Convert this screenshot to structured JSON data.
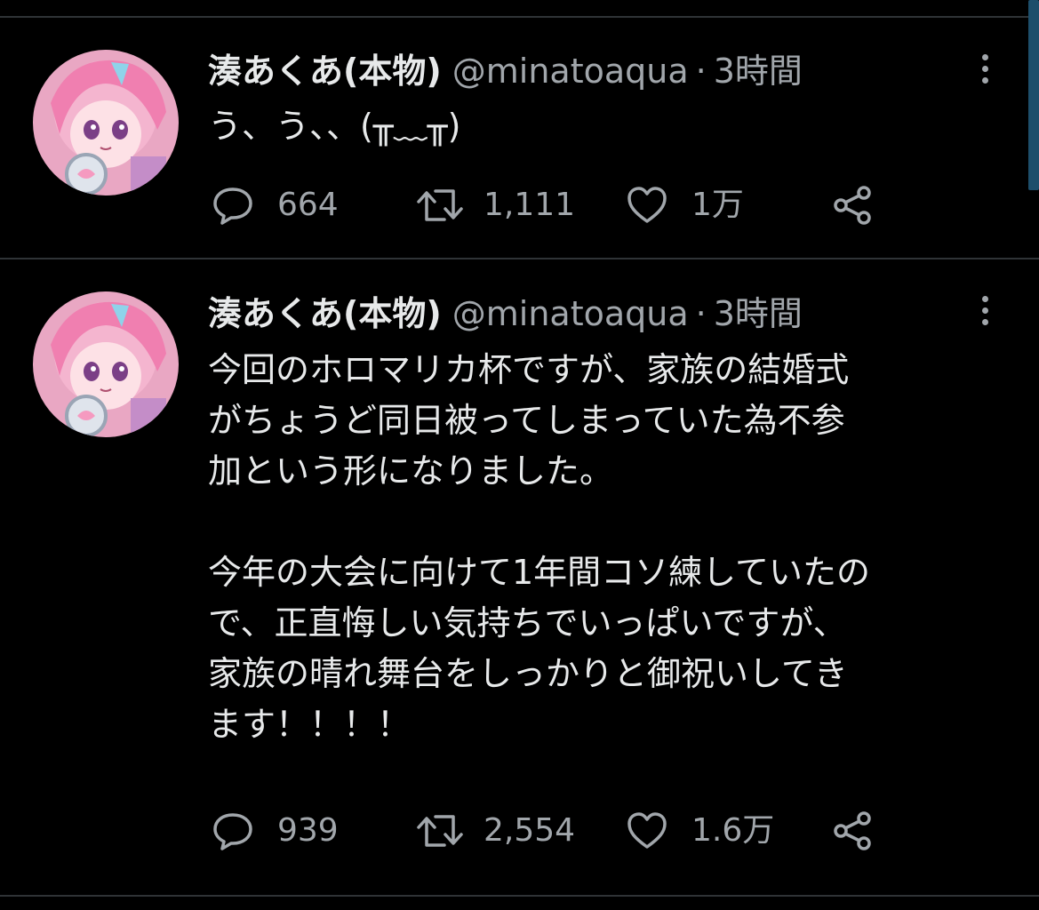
{
  "tweets": [
    {
      "name": "湊あくあ(本物)",
      "handle": "@minatoaqua",
      "separator": "·",
      "time": "3時間",
      "text": "う、う、、(╥﹏╥)",
      "replies": "664",
      "retweets": "1,111",
      "likes": "1万"
    },
    {
      "name": "湊あくあ(本物)",
      "handle": "@minatoaqua",
      "separator": "·",
      "time": "3時間",
      "text": "今回のホロマリカ杯ですが、家族の結婚式\nがちょうど同日被ってしまっていた為不参\n加という形になりました。\n\n今年の大会に向けて1年間コソ練していたの\nで、正直悔しい気持ちでいっぱいですが、\n家族の晴れ舞台をしっかりと御祝いしてき\nます！！！！",
      "replies": "939",
      "retweets": "2,554",
      "likes": "1.6万"
    }
  ],
  "icons": {
    "reply": "reply-icon",
    "retweet": "retweet-icon",
    "like": "heart-icon",
    "share": "share-icon",
    "more": "more-vertical-icon"
  },
  "colors": {
    "background": "#000000",
    "text": "#e7e9ea",
    "muted": "#a1a6ab",
    "divider": "#2f3336"
  }
}
